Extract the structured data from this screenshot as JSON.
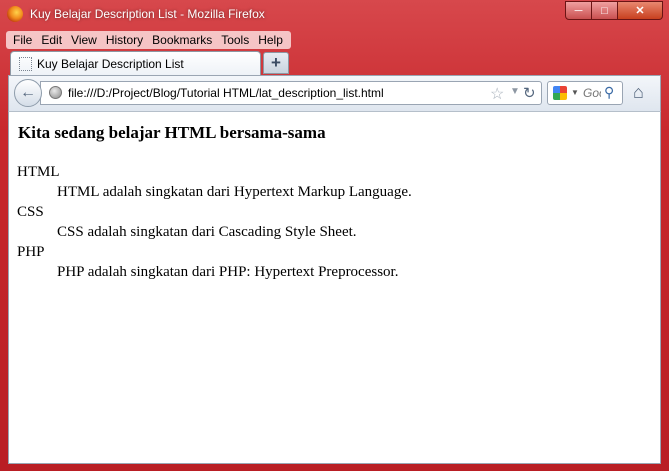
{
  "window": {
    "title": "Kuy Belajar Description List - Mozilla Firefox"
  },
  "menu": {
    "items": [
      "File",
      "Edit",
      "View",
      "History",
      "Bookmarks",
      "Tools",
      "Help"
    ]
  },
  "tab": {
    "title": "Kuy Belajar Description List",
    "new_tab_label": "+"
  },
  "navbar": {
    "url": "file:///D:/Project/Blog/Tutorial HTML/lat_description_list.html",
    "search_placeholder": "Google"
  },
  "page": {
    "heading": "Kita sedang belajar HTML bersama-sama",
    "terms": [
      {
        "term": "HTML",
        "description": "HTML adalah singkatan dari Hypertext Markup Language."
      },
      {
        "term": "CSS",
        "description": "CSS adalah singkatan dari Cascading Style Sheet."
      },
      {
        "term": "PHP",
        "description": "PHP adalah singkatan dari PHP: Hypertext Preprocessor."
      }
    ]
  },
  "colors": {
    "chrome_red": "#c8282d",
    "page_background": "#ffffff"
  }
}
